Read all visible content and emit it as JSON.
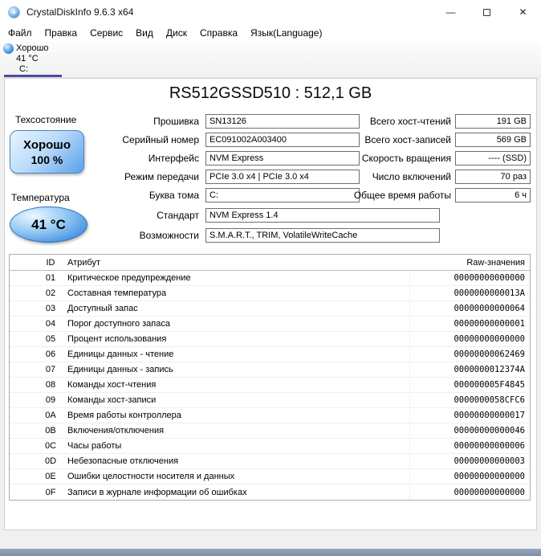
{
  "window": {
    "title": "CrystalDiskInfo 9.6.3 x64"
  },
  "window_controls": {
    "minimize": "—",
    "close": "✕"
  },
  "menu": {
    "items": [
      "Файл",
      "Правка",
      "Сервис",
      "Вид",
      "Диск",
      "Справка",
      "Язык(Language)"
    ]
  },
  "drive_tab": {
    "status": "Хорошо",
    "temperature": "41 °C",
    "letter": "C:"
  },
  "header": {
    "model_title": "RS512GSSD510 : 512,1 GB"
  },
  "health": {
    "section_label": "Техсостояние",
    "status": "Хорошо",
    "percent": "100 %"
  },
  "temperature": {
    "section_label": "Температура",
    "value": "41 °C"
  },
  "info_fields": [
    {
      "label": "Прошивка",
      "value": "SN13126"
    },
    {
      "label": "Серийный номер",
      "value": "EC091002A003400"
    },
    {
      "label": "Интерфейс",
      "value": "NVM Express"
    },
    {
      "label": "Режим передачи",
      "value": "PCIe 3.0 x4 | PCIe 3.0 x4"
    },
    {
      "label": "Буква тома",
      "value": "C:"
    },
    {
      "label": "Стандарт",
      "value": "NVM Express 1.4"
    },
    {
      "label": "Возможности",
      "value": "S.M.A.R.T., TRIM, VolatileWriteCache"
    }
  ],
  "stat_fields": [
    {
      "label": "Всего хост-чтений",
      "value": "191 GB"
    },
    {
      "label": "Всего хост-записей",
      "value": "569 GB"
    },
    {
      "label": "Скорость вращения",
      "value": "---- (SSD)"
    },
    {
      "label": "Число включений",
      "value": "70 раз"
    },
    {
      "label": "Общее время работы",
      "value": "6 ч"
    }
  ],
  "smart_table": {
    "headers": {
      "id": "ID",
      "attribute": "Атрибут",
      "raw": "Raw-значения"
    },
    "rows": [
      {
        "id": "01",
        "attribute": "Критическое предупреждение",
        "raw": "00000000000000"
      },
      {
        "id": "02",
        "attribute": "Составная температура",
        "raw": "0000000000013A"
      },
      {
        "id": "03",
        "attribute": "Доступный запас",
        "raw": "00000000000064"
      },
      {
        "id": "04",
        "attribute": "Порог доступного запаса",
        "raw": "00000000000001"
      },
      {
        "id": "05",
        "attribute": "Процент использования",
        "raw": "00000000000000"
      },
      {
        "id": "06",
        "attribute": "Единицы данных - чтение",
        "raw": "00000000062469"
      },
      {
        "id": "07",
        "attribute": "Единицы данных - запись",
        "raw": "0000000012374A"
      },
      {
        "id": "08",
        "attribute": "Команды хост-чтения",
        "raw": "000000005F4845"
      },
      {
        "id": "09",
        "attribute": "Команды хост-записи",
        "raw": "0000000058CFC6"
      },
      {
        "id": "0A",
        "attribute": "Время работы контроллера",
        "raw": "00000000000017"
      },
      {
        "id": "0B",
        "attribute": "Включения/отключения",
        "raw": "00000000000046"
      },
      {
        "id": "0C",
        "attribute": "Часы работы",
        "raw": "00000000000006"
      },
      {
        "id": "0D",
        "attribute": "Небезопасные отключения",
        "raw": "00000000000003"
      },
      {
        "id": "0E",
        "attribute": "Ошибки целостности носителя и данных",
        "raw": "00000000000000"
      },
      {
        "id": "0F",
        "attribute": "Записи в журнале информации об ошибках",
        "raw": "00000000000000"
      }
    ]
  }
}
